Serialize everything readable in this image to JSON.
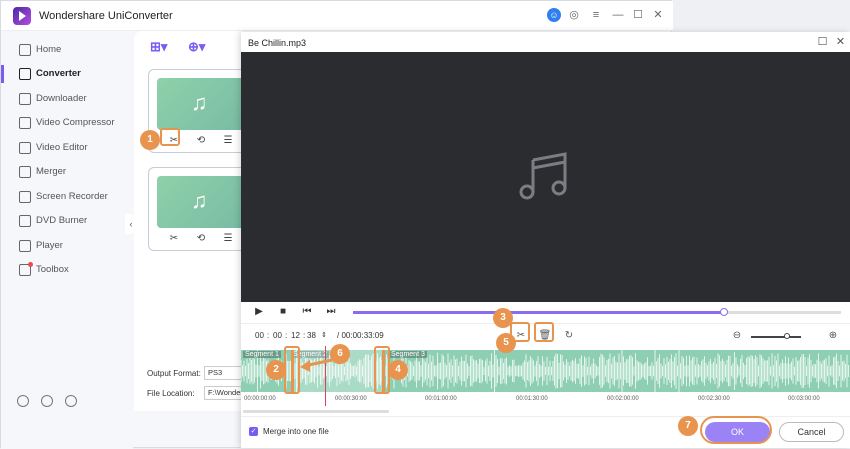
{
  "app": {
    "title": "Wondershare UniConverter",
    "colors": {
      "accent": "#7b5cf0",
      "callout": "#e8944f",
      "waveform": "#8ecfb3"
    }
  },
  "sidebar": {
    "items": [
      {
        "label": "Home",
        "icon": "home-icon"
      },
      {
        "label": "Converter",
        "icon": "converter-icon",
        "active": true
      },
      {
        "label": "Downloader",
        "icon": "download-icon"
      },
      {
        "label": "Video Compressor",
        "icon": "compress-icon"
      },
      {
        "label": "Video Editor",
        "icon": "edit-icon"
      },
      {
        "label": "Merger",
        "icon": "merge-icon"
      },
      {
        "label": "Screen Recorder",
        "icon": "record-icon"
      },
      {
        "label": "DVD Burner",
        "icon": "dvd-icon"
      },
      {
        "label": "Player",
        "icon": "play-icon"
      },
      {
        "label": "Toolbox",
        "icon": "toolbox-icon"
      }
    ]
  },
  "main": {
    "output_format_label": "Output Format:",
    "output_format_value": "PS3",
    "file_location_label": "File Location:",
    "file_location_value": "F:\\Wonder"
  },
  "dialog": {
    "title": "Be Chillin.mp3",
    "time": {
      "h": "00",
      "m": "00",
      "s": "12",
      "f": "38",
      "duration": "/ 00:00:33:09"
    },
    "segments": [
      "Segment 1",
      "Segment 2",
      "Segment 3"
    ],
    "ticks": [
      "00:00:00:00",
      "00:00:30:00",
      "00:01:00:00",
      "00:01:30:00",
      "00:02:00:00",
      "00:02:30:00",
      "00:03:00:00"
    ],
    "merge_label": "Merge into one file",
    "ok_label": "OK",
    "cancel_label": "Cancel",
    "seek_progress": 0.76,
    "zoom_level": 0.72
  },
  "callouts": [
    "1",
    "2",
    "3",
    "4",
    "5",
    "6",
    "7"
  ]
}
